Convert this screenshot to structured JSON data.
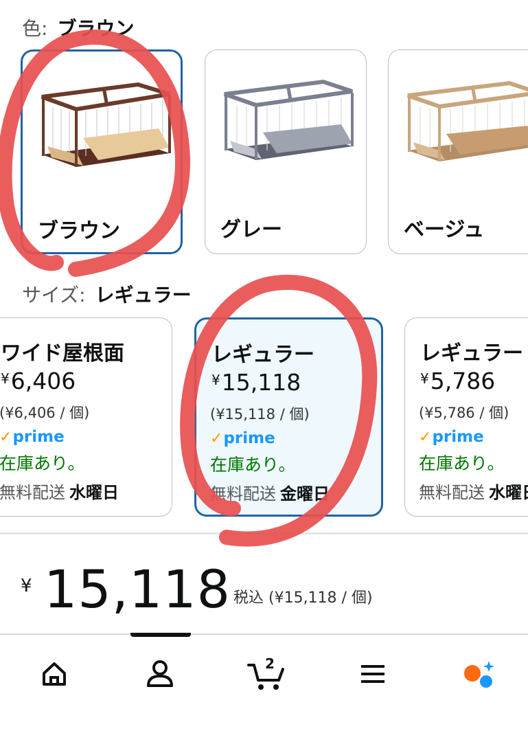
{
  "color_selector": {
    "label": "色:",
    "selected_value": "ブラウン",
    "options": [
      {
        "name": "ブラウン",
        "frame_color": "#6b3a2a",
        "selected": true
      },
      {
        "name": "グレー",
        "frame_color": "#7a8090",
        "selected": false
      },
      {
        "name": "ベージュ",
        "frame_color": "#c9a57c",
        "selected": false
      }
    ]
  },
  "size_selector": {
    "label": "サイズ:",
    "selected_value": "レギュラー",
    "options": [
      {
        "title": "ワイド屋根面",
        "yen": "¥",
        "price": "6,406",
        "unit_price": "(¥6,406 / 個)",
        "prime": "prime",
        "stock": "在庫あり。",
        "delivery_label": "無料配送",
        "delivery_day": "水曜日",
        "selected": false
      },
      {
        "title": "レギュラー",
        "yen": "¥",
        "price": "15,118",
        "unit_price": "(¥15,118 / 個)",
        "prime": "prime",
        "stock": "在庫あり。",
        "delivery_label": "無料配送",
        "delivery_day": "金曜日",
        "selected": true
      },
      {
        "title": "レギュラー",
        "yen": "¥",
        "price": "5,786",
        "unit_price": "(¥5,786 / 個)",
        "prime": "prime",
        "stock": "在庫あり。",
        "delivery_label": "無料配送",
        "delivery_day": "水曜日",
        "selected": false
      }
    ]
  },
  "price_summary": {
    "yen": "¥",
    "amount": "15,118",
    "tax_note": "税込 (¥15,118 / 個)"
  },
  "bottom_nav": {
    "items": [
      "home-icon",
      "account-icon",
      "cart-icon",
      "menu-icon",
      "rufus-assistant-icon"
    ],
    "cart_count": "2",
    "active_index": 1
  },
  "colors": {
    "accent_blue": "#2162a1",
    "selected_bg": "#eef8fd",
    "prime_blue": "#1a98ff",
    "prime_check": "#ff9900",
    "in_stock_green": "#007600",
    "annotation_red": "#e84f4f"
  }
}
